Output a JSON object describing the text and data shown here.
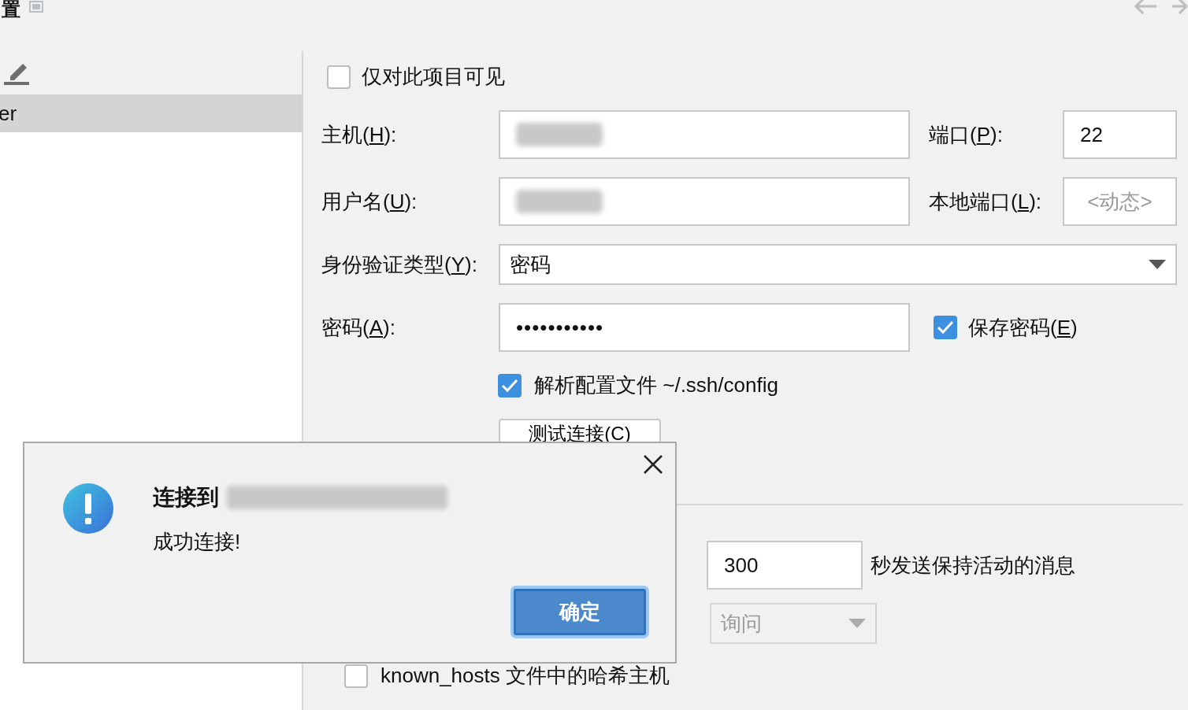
{
  "window": {
    "title": "置"
  },
  "sidebar": {
    "items": [
      {
        "label": "er",
        "selected": true
      }
    ]
  },
  "visible_only": {
    "label": "仅对此项目可见",
    "checked": false
  },
  "host": {
    "label": [
      "主机(",
      "H",
      "):"
    ],
    "redacted": true
  },
  "port": {
    "label": [
      "端口(",
      "P",
      "):"
    ],
    "value": "22"
  },
  "username": {
    "label": [
      "用户名(",
      "U",
      "):"
    ],
    "redacted": true
  },
  "local_port": {
    "label": [
      "本地端口(",
      "L",
      "):"
    ],
    "placeholder": "<动态>"
  },
  "auth_type": {
    "label": [
      "身份验证类型(",
      "Y",
      "):"
    ],
    "value": "密码"
  },
  "password": {
    "label": [
      "密码(",
      "A",
      "):"
    ],
    "value": "•••••••••••"
  },
  "save_password": {
    "label": [
      "保存密码(",
      "E",
      ")"
    ],
    "checked": true
  },
  "parse_config": {
    "label": "解析配置文件 ~/.ssh/config",
    "checked": true
  },
  "test_button": {
    "label": "测试连接(C)"
  },
  "keepalive": {
    "value": "300",
    "suffix": "秒发送保持活动的消息"
  },
  "host_key_select": {
    "value": "询问",
    "disabled": true
  },
  "hash_hosts": {
    "label": "known_hosts 文件中的哈希主机",
    "checked": false
  },
  "dialog": {
    "title": "连接到",
    "redacted": true,
    "message": "成功连接!",
    "ok_button": "确定"
  }
}
